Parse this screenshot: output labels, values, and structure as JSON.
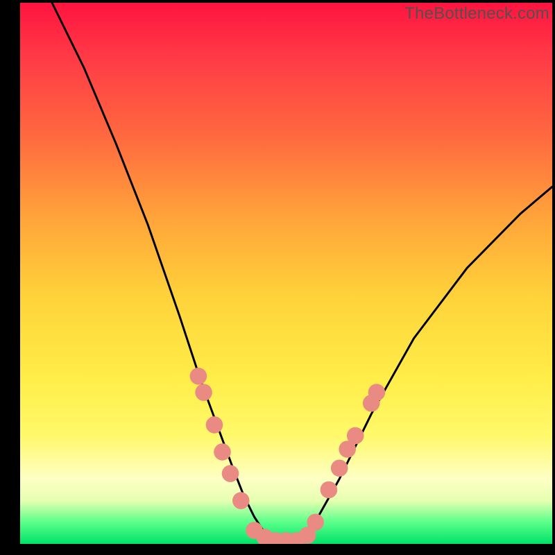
{
  "watermark": "TheBottleneck.com",
  "chart_data": {
    "type": "line",
    "title": "",
    "xlabel": "",
    "ylabel": "",
    "xlim": [
      0,
      100
    ],
    "ylim": [
      0,
      100
    ],
    "grid": false,
    "legend": false,
    "background_gradient": {
      "orientation": "vertical",
      "stops": [
        {
          "pos": 0.0,
          "color": "#ff143f"
        },
        {
          "pos": 0.25,
          "color": "#ff6a3f"
        },
        {
          "pos": 0.55,
          "color": "#ffd43a"
        },
        {
          "pos": 0.88,
          "color": "#fdffc4"
        },
        {
          "pos": 1.0,
          "color": "#00e268"
        }
      ]
    },
    "series": [
      {
        "name": "bottleneck-curve",
        "color": "#000000",
        "x": [
          6,
          12,
          18,
          24,
          30,
          34,
          37,
          40,
          42,
          44,
          46,
          48,
          50,
          52,
          54,
          56,
          60,
          66,
          74,
          84,
          94,
          100
        ],
        "y": [
          100,
          88,
          74,
          59,
          42,
          30,
          22,
          14,
          9,
          5,
          2,
          0,
          0,
          0,
          2,
          5,
          12,
          24,
          38,
          51,
          61,
          66
        ]
      }
    ],
    "markers": {
      "name": "highlight-dots",
      "color": "#e98b83",
      "radius_pct": 1.6,
      "points": [
        {
          "x": 33.5,
          "y": 31
        },
        {
          "x": 34.5,
          "y": 28
        },
        {
          "x": 36.5,
          "y": 22
        },
        {
          "x": 38.0,
          "y": 17
        },
        {
          "x": 39.5,
          "y": 13
        },
        {
          "x": 41.5,
          "y": 8
        },
        {
          "x": 44.0,
          "y": 2.5
        },
        {
          "x": 46.0,
          "y": 1.2
        },
        {
          "x": 48.0,
          "y": 0.6
        },
        {
          "x": 50.0,
          "y": 0.6
        },
        {
          "x": 52.0,
          "y": 0.6
        },
        {
          "x": 54.0,
          "y": 1.6
        },
        {
          "x": 55.5,
          "y": 4
        },
        {
          "x": 58.0,
          "y": 10
        },
        {
          "x": 60.0,
          "y": 14
        },
        {
          "x": 61.5,
          "y": 17.5
        },
        {
          "x": 63.0,
          "y": 20
        },
        {
          "x": 66.0,
          "y": 26
        },
        {
          "x": 67.0,
          "y": 28
        }
      ]
    }
  }
}
